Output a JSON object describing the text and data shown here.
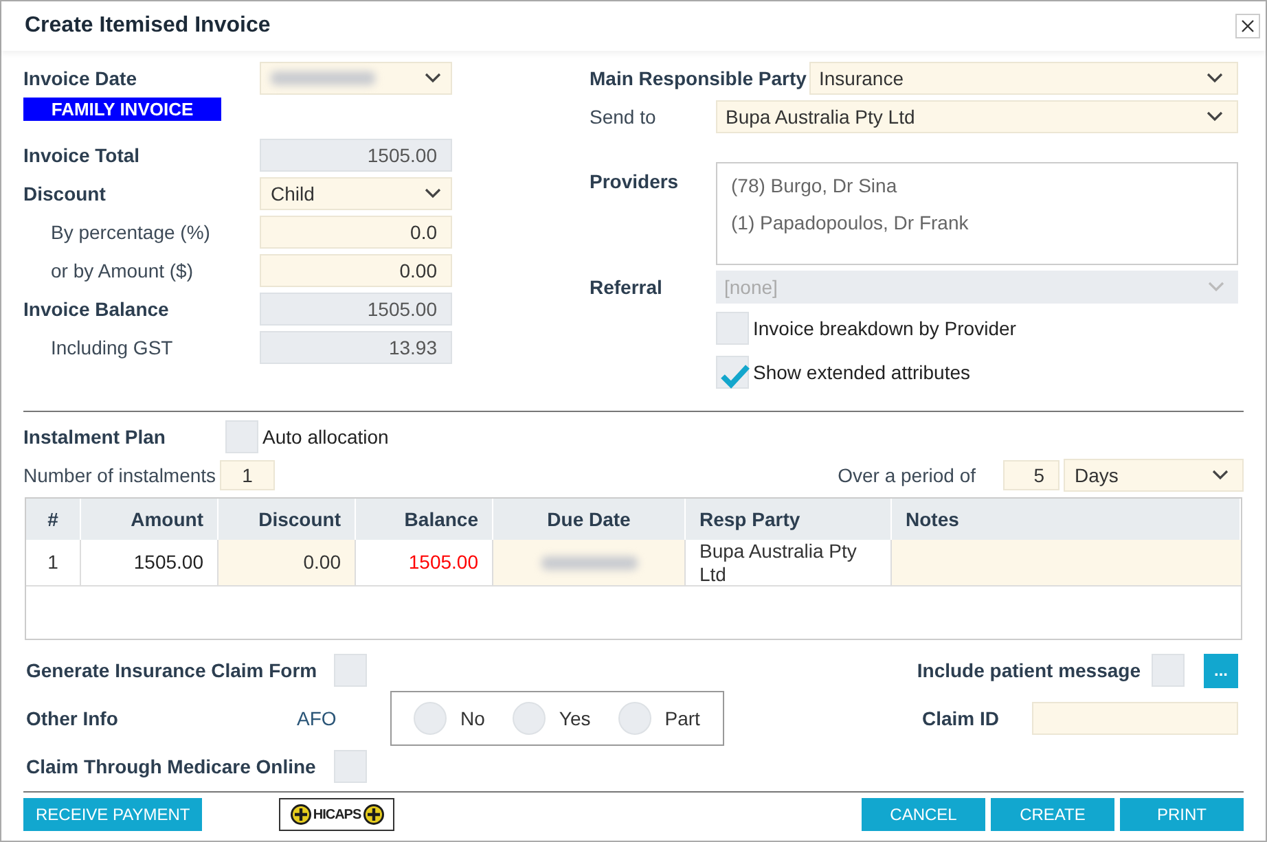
{
  "window": {
    "title": "Create Itemised Invoice"
  },
  "invoice_fields": [
    {
      "kind": "redacted_select",
      "label": "Invoice Date",
      "sub": false
    },
    {
      "kind": "badge",
      "value": "FAMILY INVOICE"
    },
    {
      "kind": "readonly",
      "label": "Invoice Total",
      "value": "1505.00",
      "sub": false
    },
    {
      "kind": "select",
      "label": "Discount",
      "value": "Child",
      "sub": false
    },
    {
      "kind": "input",
      "label": "By percentage (%)",
      "value": "0.0",
      "sub": true
    },
    {
      "kind": "input",
      "label": "or by Amount ($)",
      "value": "0.00",
      "sub": true
    },
    {
      "kind": "readonly",
      "label": "Invoice Balance",
      "value": "1505.00",
      "sub": false
    },
    {
      "kind": "readonly",
      "label": "Including GST",
      "value": "13.93",
      "sub": true
    }
  ],
  "main_responsible_party": {
    "label": "Main Responsible Party",
    "value": "Insurance"
  },
  "send_to": {
    "label": "Send to",
    "value": "Bupa Australia Pty Ltd"
  },
  "providers": {
    "label": "Providers",
    "items": [
      "(78) Burgo, Dr Sina",
      "(1) Papadopoulos, Dr Frank"
    ]
  },
  "referral": {
    "label": "Referral",
    "value": "[none]",
    "disabled": true
  },
  "options": [
    {
      "label": "Invoice breakdown by Provider",
      "checked": false
    },
    {
      "label": "Show extended attributes",
      "checked": true
    }
  ],
  "instalment": {
    "label": "Instalment Plan",
    "auto_allocation": {
      "label": "Auto allocation",
      "checked": false
    },
    "count_label": "Number of instalments",
    "count": "1",
    "period_label": "Over a period of",
    "period": "5",
    "period_unit": "Days"
  },
  "table": {
    "columns": [
      "#",
      "Amount",
      "Discount",
      "Balance",
      "Due Date",
      "Resp Party",
      "Notes"
    ],
    "rows": [
      {
        "number": "1",
        "amount": "1505.00",
        "discount": "0.00",
        "balance": "1505.00",
        "resp_party": "Bupa Australia Pty Ltd"
      }
    ]
  },
  "generate_claim": {
    "label": "Generate Insurance Claim Form",
    "checked": false
  },
  "include_message": {
    "label": "Include patient message",
    "checked": false,
    "button": "..."
  },
  "other_info": {
    "label": "Other Info",
    "code": "AFO",
    "options": [
      {
        "label": "No",
        "selected": false
      },
      {
        "label": "Yes",
        "selected": false
      },
      {
        "label": "Part",
        "selected": false
      }
    ]
  },
  "claim_id": {
    "label": "Claim ID"
  },
  "medicare": {
    "label": "Claim Through Medicare Online",
    "checked": false
  },
  "footer": {
    "left_buttons": [
      "RECEIVE PAYMENT"
    ],
    "logo": "HICAPS",
    "right_buttons": [
      "CANCEL",
      "CREATE",
      "PRINT"
    ]
  }
}
